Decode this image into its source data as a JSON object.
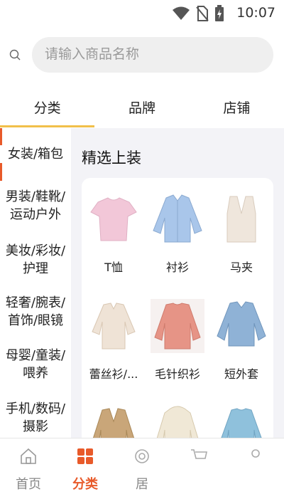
{
  "status_bar": {
    "time": "10:07"
  },
  "search": {
    "placeholder": "请输入商品名称"
  },
  "tabs": [
    {
      "label": "分类",
      "active": true
    },
    {
      "label": "品牌",
      "active": false
    },
    {
      "label": "店铺",
      "active": false
    }
  ],
  "sidebar": {
    "items": [
      {
        "label": "女装/箱包",
        "active": true
      },
      {
        "label": "男装/鞋靴/运动户外",
        "active": false
      },
      {
        "label": "美妆/彩妆/护理",
        "active": false
      },
      {
        "label": "轻奢/腕表/首饰/眼镜",
        "active": false
      },
      {
        "label": "母婴/童装/喂养",
        "active": false
      },
      {
        "label": "手机/数码/摄影",
        "active": false
      }
    ]
  },
  "main": {
    "section_title": "精选上装",
    "products": [
      {
        "label": "T恤",
        "icon": "tshirt-icon",
        "color": "#f2c7d8"
      },
      {
        "label": "衬衫",
        "icon": "shirt-icon",
        "color": "#a9c6ea"
      },
      {
        "label": "马夹",
        "icon": "vest-icon",
        "color": "#efe6dc"
      },
      {
        "label": "蕾丝衫/...",
        "icon": "lace-top-icon",
        "color": "#efe3d6"
      },
      {
        "label": "毛针织衫",
        "icon": "sweater-icon",
        "color": "#e69486"
      },
      {
        "label": "短外套",
        "icon": "denim-jacket-icon",
        "color": "#8fb2d6"
      },
      {
        "label": "",
        "icon": "blazer-icon",
        "color": "#c9a679"
      },
      {
        "label": "",
        "icon": "hoodie-icon",
        "color": "#f0e8d6"
      },
      {
        "label": "",
        "icon": "sweatshirt-icon",
        "color": "#8fc1dc"
      }
    ]
  },
  "bottom_nav": [
    {
      "label": "首页",
      "icon": "home-icon",
      "active": false
    },
    {
      "label": "分类",
      "icon": "category-icon",
      "active": true
    },
    {
      "label": "居",
      "icon": "discover-icon",
      "active": false
    },
    {
      "label": "",
      "icon": "cart-icon",
      "active": false
    },
    {
      "label": "",
      "icon": "profile-icon",
      "active": false
    }
  ],
  "colors": {
    "accent": "#e85a2a",
    "tab_underline": "#f1c04a"
  }
}
